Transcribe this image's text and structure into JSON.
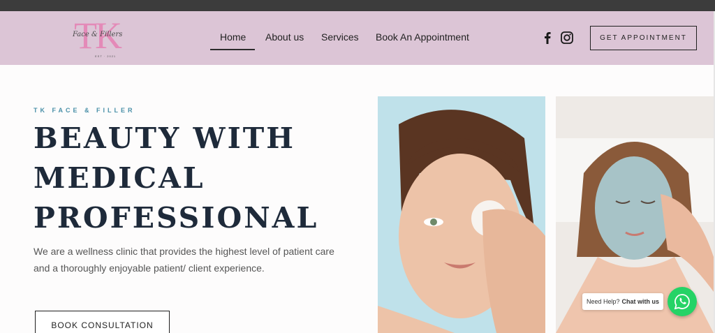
{
  "header": {
    "logo": {
      "initials": "TK",
      "script": "Face & Fillers",
      "small": "EST · 2021"
    },
    "nav": [
      {
        "label": "Home",
        "active": true
      },
      {
        "label": "About us"
      },
      {
        "label": "Services"
      },
      {
        "label": "Book An Appointment"
      }
    ],
    "social_icons": [
      "facebook-icon",
      "instagram-icon"
    ],
    "cta_label": "GET APPOINTMENT"
  },
  "hero": {
    "eyebrow": "TK FACE & FILLER",
    "headline": [
      "BEAUTY WITH",
      "MEDICAL",
      "PROFESSIONAL"
    ],
    "description": "We are a wellness clinic that provides the highest level of patient care and a thoroughly enjoyable patient/ client experience.",
    "button_label": "BOOK CONSULTATION"
  },
  "chat": {
    "prefix": "Need Help?",
    "action": "Chat with us",
    "icon": "whatsapp-icon"
  },
  "colors": {
    "header_bg": "#dcc5d6",
    "accent_pink": "#e48ab8",
    "headline": "#1e2a3a",
    "eyebrow": "#4a90a8",
    "whatsapp": "#25d366"
  }
}
